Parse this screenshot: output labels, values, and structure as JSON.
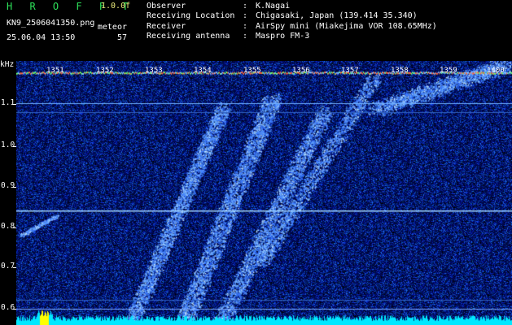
{
  "header": {
    "brand": "H R O F F T",
    "version": "1.0.0f",
    "filename": "KN9_2506041350.png",
    "timestamp": "25.06.04 13:50",
    "meteor_label": "meteor",
    "meteor_count": "57",
    "info": [
      {
        "key": "Observer",
        "value": "K.Nagai"
      },
      {
        "key": "Receiving Location",
        "value": "Chigasaki, Japan (139.414 35.340)"
      },
      {
        "key": "Receiver",
        "value": "AirSpy mini (Miakejima VOR 108.65MHz)"
      },
      {
        "key": "Receiving antenna",
        "value": "Maspro FM-3"
      }
    ]
  },
  "y_axis": {
    "unit": "kHz",
    "ticks": [
      "1.1",
      "1.0",
      "0.9",
      "0.8",
      "0.7",
      "0.6"
    ],
    "tick_values": [
      1.1,
      1.0,
      0.9,
      0.8,
      0.7,
      0.6
    ]
  },
  "x_axis": {
    "ticks": [
      "1351",
      "1352",
      "1353",
      "1354",
      "1355",
      "1356",
      "1357",
      "1358",
      "1359",
      "1400"
    ]
  },
  "colors": {
    "background": "#000000",
    "noise": "#1a2c8f",
    "signal": "#6fb0ff",
    "carrier": "#9fd4ff",
    "bottom_bar": "#00e8ff",
    "brand": "#2de05a"
  }
}
